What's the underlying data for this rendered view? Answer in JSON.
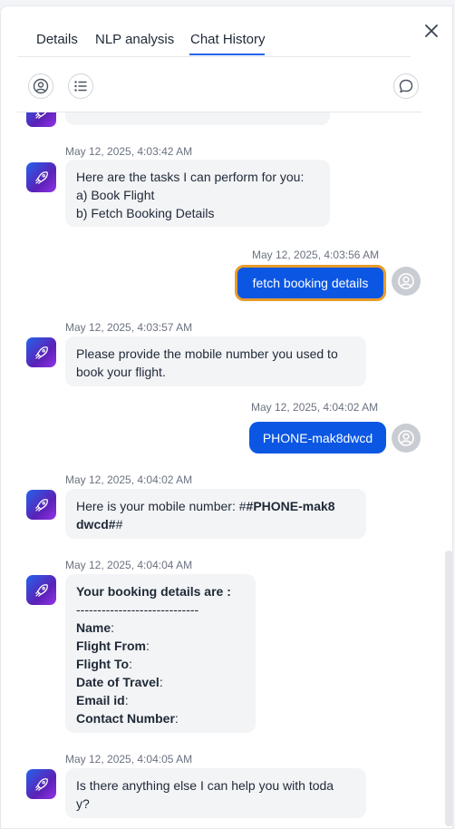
{
  "tabs": [
    {
      "label": "Details"
    },
    {
      "label": "NLP analysis"
    },
    {
      "label": "Chat History"
    }
  ],
  "active_tab": "Chat History",
  "icons": {
    "close": "close-icon",
    "user_filter": "user-circle-icon",
    "list_view": "list-icon",
    "comment": "comment-icon",
    "bot": "rocket-icon",
    "user": "user-avatar-icon"
  },
  "colors": {
    "accent": "#2563eb",
    "user_bubble": "#0b57e3",
    "focus_ring": "#e89c2c",
    "bot_bubble": "#f3f4f6"
  },
  "messages": [
    {
      "timestamp": "May 12, 2025, 4:03:42 AM",
      "sender": "bot",
      "lines": [
        "Here are the tasks I can perform for you:",
        "a) Book Flight",
        "b) Fetch Booking Details"
      ]
    },
    {
      "timestamp": "May 12, 2025, 4:03:56 AM",
      "sender": "user",
      "text": "fetch booking details"
    },
    {
      "timestamp": "May 12, 2025, 4:03:57 AM",
      "sender": "bot",
      "lines": [
        "Please provide the mobile number you used to",
        "book your flight."
      ]
    },
    {
      "timestamp": "May 12, 2025, 4:04:02 AM",
      "sender": "user",
      "text": "PHONE-mak8dwcd"
    },
    {
      "timestamp": "May 12, 2025, 4:04:02 AM",
      "sender": "bot",
      "prefix": "Here is your mobile number: #",
      "bold_part1": "#PHONE-mak8",
      "bold_part2": "dwcd#",
      "suffix": "#"
    },
    {
      "timestamp": "May 12, 2025, 4:04:04 AM",
      "sender": "bot",
      "heading": "Your booking details are :",
      "divider": "-----------------------------",
      "fields": [
        {
          "label": "Name",
          "sep": ":"
        },
        {
          "label": "Flight From",
          "sep": ":"
        },
        {
          "label": "Flight To",
          "sep": ":"
        },
        {
          "label": "Date of Travel",
          "sep": ":"
        },
        {
          "label": "Email id",
          "sep": ":"
        },
        {
          "label": "Contact Number",
          "sep": ":"
        }
      ]
    },
    {
      "timestamp": "May 12, 2025, 4:04:05 AM",
      "sender": "bot",
      "lines": [
        "Is there anything else I can help you with toda",
        "y?"
      ]
    }
  ]
}
